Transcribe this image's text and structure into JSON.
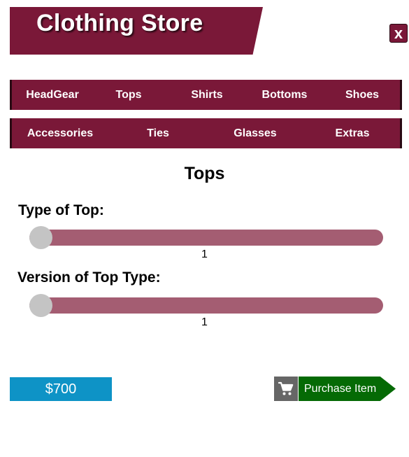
{
  "header": {
    "title": "Clothing Store",
    "close_label": "x"
  },
  "nav": {
    "row1": [
      "HeadGear",
      "Tops",
      "Shirts",
      "Bottoms",
      "Shoes"
    ],
    "row2": [
      "Accessories",
      "Ties",
      "Glasses",
      "Extras"
    ]
  },
  "section": {
    "title": "Tops"
  },
  "sliders": [
    {
      "label": "Type of Top:",
      "value": "1"
    },
    {
      "label": "Version of Top Type:",
      "value": "1"
    }
  ],
  "footer": {
    "price": "$700",
    "purchase_label": "Purchase Item"
  },
  "icons": {
    "cart": "shopping-cart-icon",
    "close": "close-icon"
  },
  "colors": {
    "accent": "#7a1838",
    "slider_track": "#a45d72",
    "price": "#0e93c6",
    "purchase": "#056a05"
  }
}
